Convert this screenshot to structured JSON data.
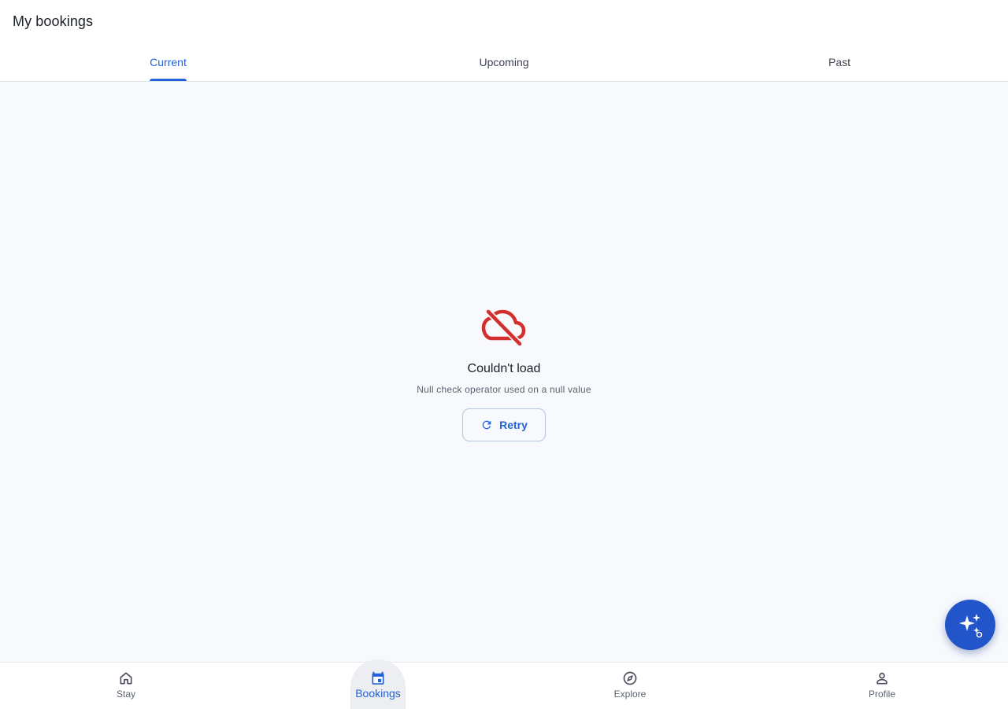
{
  "header": {
    "title": "My bookings",
    "tabs": [
      {
        "label": "Current",
        "active": true
      },
      {
        "label": "Upcoming",
        "active": false
      },
      {
        "label": "Past",
        "active": false
      }
    ]
  },
  "error": {
    "icon": "cloud-off-icon",
    "title": "Couldn't load",
    "message": "Null check operator used on a null value",
    "retry_label": "Retry"
  },
  "fab": {
    "icon": "sparkle-icon"
  },
  "bottom_nav": [
    {
      "label": "Stay",
      "icon": "home-icon",
      "active": false
    },
    {
      "label": "Bookings",
      "icon": "calendar-icon",
      "active": true
    },
    {
      "label": "Explore",
      "icon": "compass-icon",
      "active": false
    },
    {
      "label": "Profile",
      "icon": "person-icon",
      "active": false
    }
  ],
  "colors": {
    "accent": "#2462d9",
    "error": "#d32f2f",
    "fab": "#2155c9",
    "background": "#f7f9fc"
  }
}
